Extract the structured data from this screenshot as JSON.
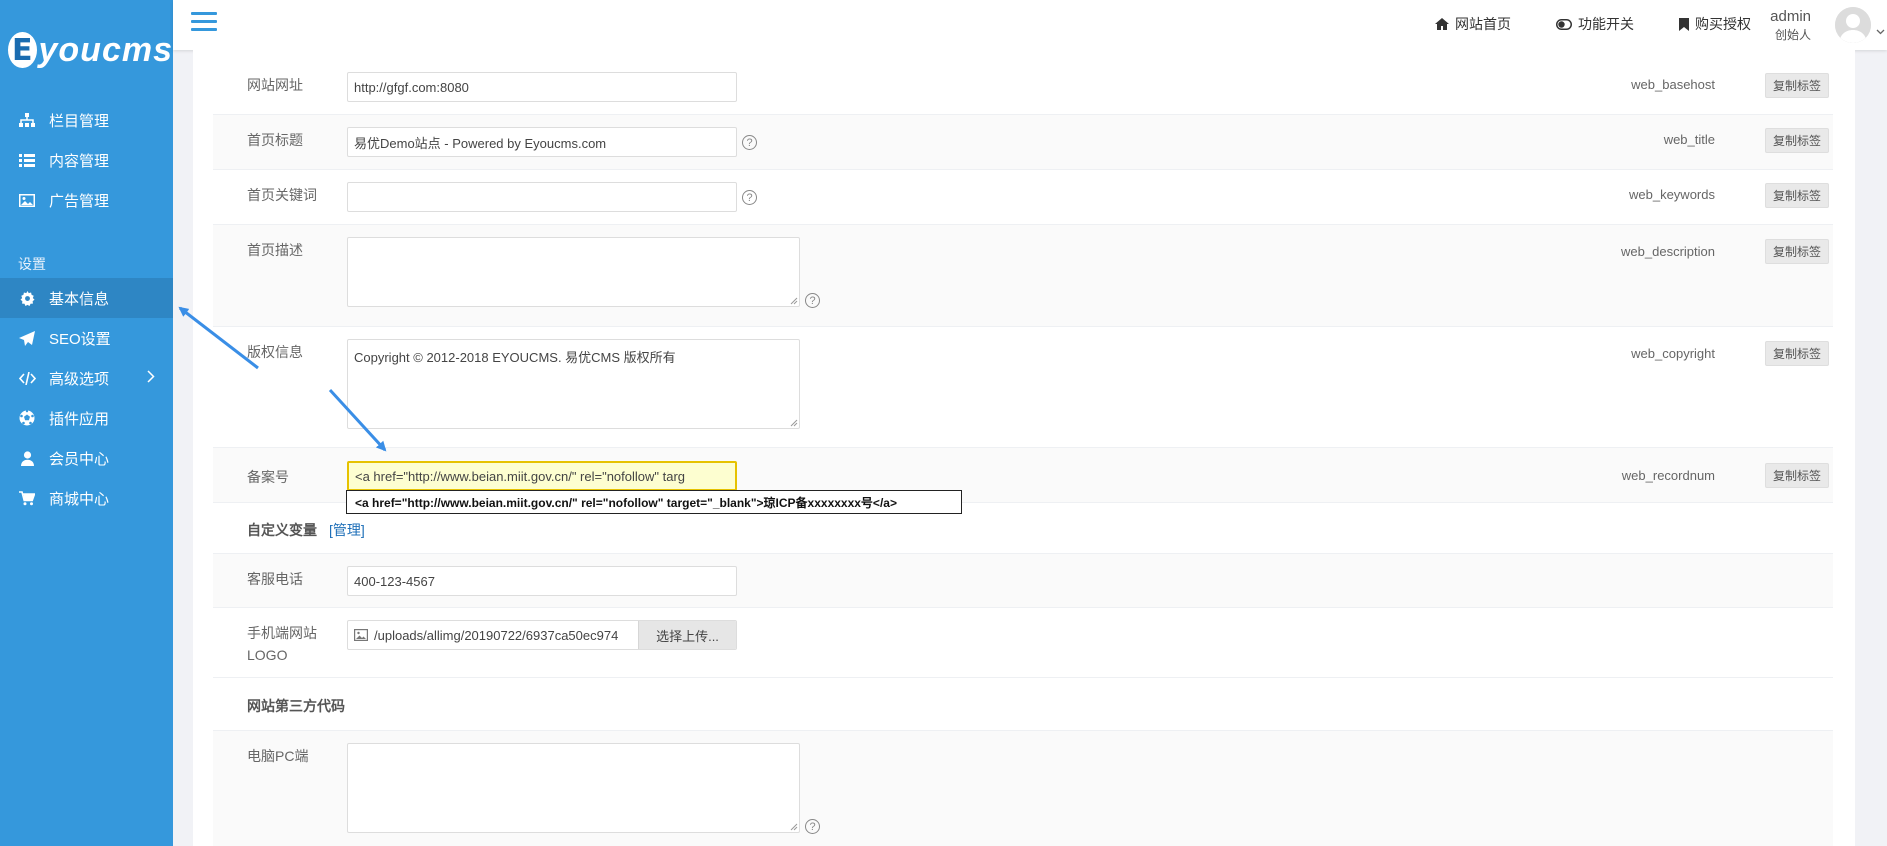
{
  "brand": {
    "mark": "E",
    "text": "youcms"
  },
  "sidebar": {
    "items": [
      {
        "label": "栏目管理",
        "icon": "sitemap-icon"
      },
      {
        "label": "内容管理",
        "icon": "list-icon"
      },
      {
        "label": "广告管理",
        "icon": "image-icon"
      }
    ],
    "group_label": "设置",
    "settings_items": [
      {
        "label": "基本信息",
        "icon": "gear-icon",
        "active": true
      },
      {
        "label": "SEO设置",
        "icon": "send-icon"
      },
      {
        "label": "高级选项",
        "icon": "code-icon",
        "has_children": true
      },
      {
        "label": "插件应用",
        "icon": "soccer-icon"
      },
      {
        "label": "会员中心",
        "icon": "user-icon"
      },
      {
        "label": "商城中心",
        "icon": "cart-icon"
      }
    ]
  },
  "topbar": {
    "home_label": "网站首页",
    "toggle_label": "功能开关",
    "buy_label": "购买授权",
    "user_name": "admin",
    "user_role": "创始人"
  },
  "form": {
    "web_basehost": {
      "label": "网站网址",
      "value": "http://gfgf.com:8080",
      "tag": "web_basehost"
    },
    "web_title": {
      "label": "首页标题",
      "value": "易优Demo站点 -  Powered by Eyoucms.com",
      "tag": "web_title"
    },
    "web_keywords": {
      "label": "首页关键词",
      "value": "",
      "tag": "web_keywords"
    },
    "web_description": {
      "label": "首页描述",
      "value": "",
      "tag": "web_description"
    },
    "web_copyright": {
      "label": "版权信息",
      "value": "Copyright © 2012-2018 EYOUCMS. 易优CMS 版权所有",
      "tag": "web_copyright"
    },
    "web_recordnum": {
      "label": "备案号",
      "value": "<a href=\"http://www.beian.miit.gov.cn/\" rel=\"nofollow\" targ",
      "tag": "web_recordnum",
      "suggestion": "<a href=\"http://www.beian.miit.gov.cn/\" rel=\"nofollow\" target=\"_blank\">琼ICP备xxxxxxxx号</a>"
    },
    "copy_label": "复制标签",
    "help_glyph": "?",
    "custom_vars_title": "自定义变量",
    "custom_vars_link": "[管理]",
    "phone": {
      "label": "客服电话",
      "value": "400-123-4567"
    },
    "mobile_logo": {
      "label_line1": "手机端网站",
      "label_line2": "LOGO",
      "value": "/uploads/allimg/20190722/6937ca50ec974",
      "button": "选择上传..."
    },
    "third_party_title": "网站第三方代码",
    "pc_code": {
      "label": "电脑PC端",
      "value": ""
    }
  },
  "colors": {
    "sidebar": "#3598dc",
    "sidebar_active": "#2e86c4",
    "accent": "#1e6fb8",
    "arrow": "#3a8ee6"
  }
}
